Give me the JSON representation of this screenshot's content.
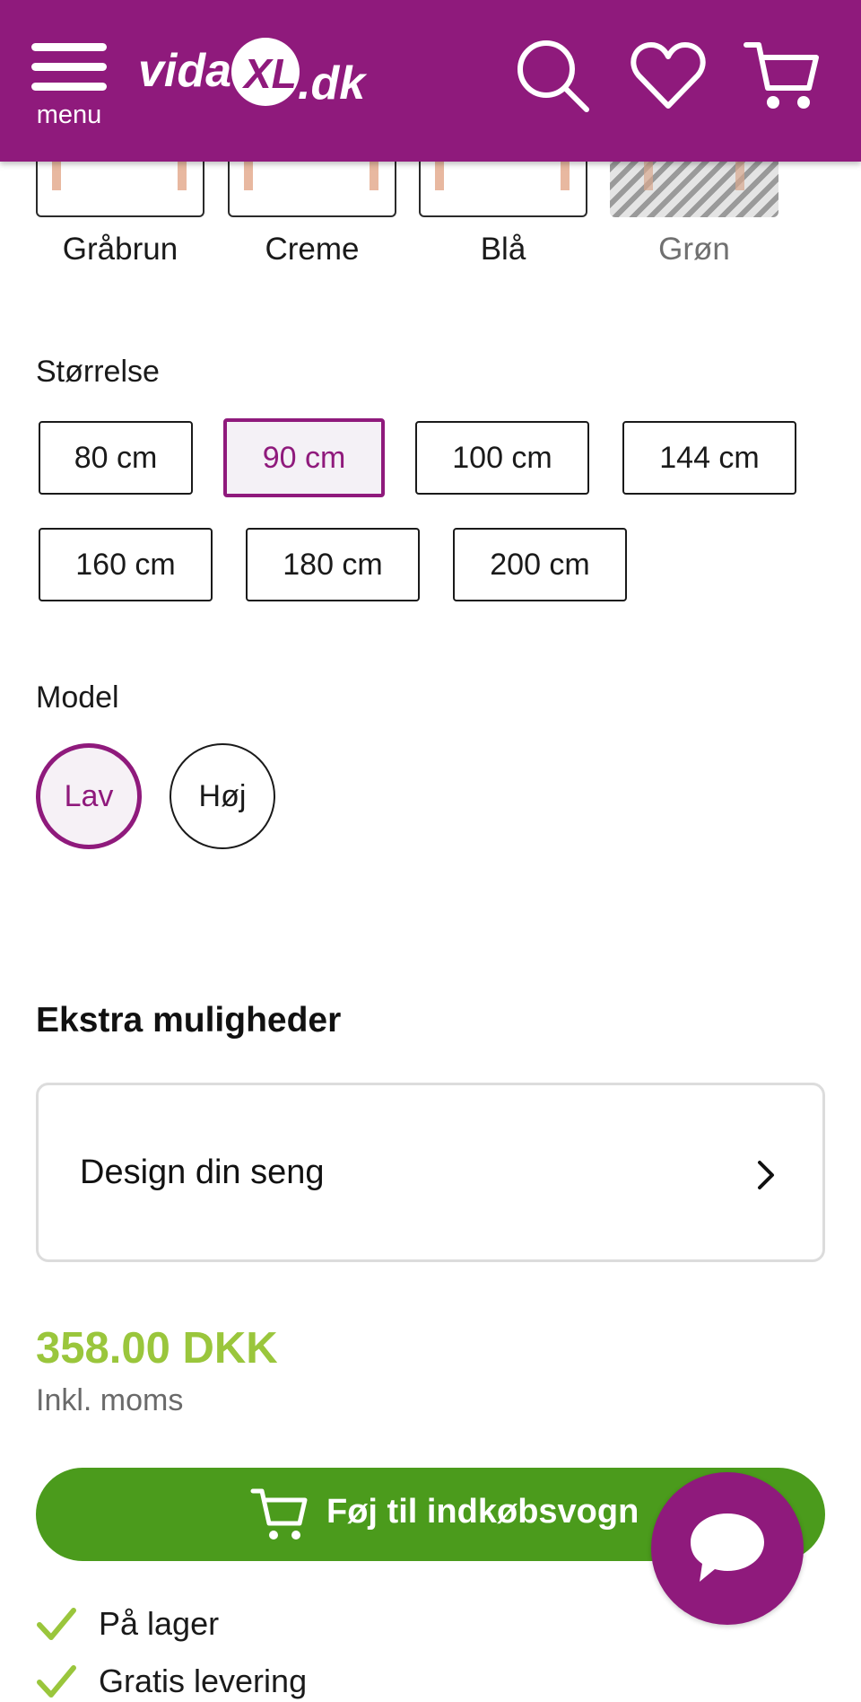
{
  "header": {
    "menu_label": "menu",
    "logo_text_main": "vida",
    "logo_text_x": "XL",
    "logo_text_tld": ".dk",
    "icons": [
      "search-icon",
      "heart-icon",
      "cart-icon"
    ],
    "brand_color": "#8f1a7c"
  },
  "colors": {
    "options": [
      {
        "label": "Gråbrun",
        "available": true
      },
      {
        "label": "Creme",
        "available": true
      },
      {
        "label": "Blå",
        "available": true
      },
      {
        "label": "Grøn",
        "available": false
      }
    ]
  },
  "size": {
    "label": "Størrelse",
    "options": [
      "80 cm",
      "90 cm",
      "100 cm",
      "144 cm",
      "160 cm",
      "180 cm",
      "200 cm"
    ],
    "selected": "90 cm"
  },
  "model": {
    "label": "Model",
    "options": [
      "Lav",
      "Høj"
    ],
    "selected": "Lav"
  },
  "extras": {
    "title": "Ekstra muligheder",
    "design_label": "Design din seng"
  },
  "price": {
    "amount": "358.00 DKK",
    "vat_note": "Inkl. moms",
    "price_color": "#9ac63c"
  },
  "cart_button": {
    "label": "Føj til indkøbsvogn",
    "color": "#4b9b1c"
  },
  "usps": [
    {
      "text": "På lager"
    },
    {
      "text": "Gratis levering"
    }
  ]
}
